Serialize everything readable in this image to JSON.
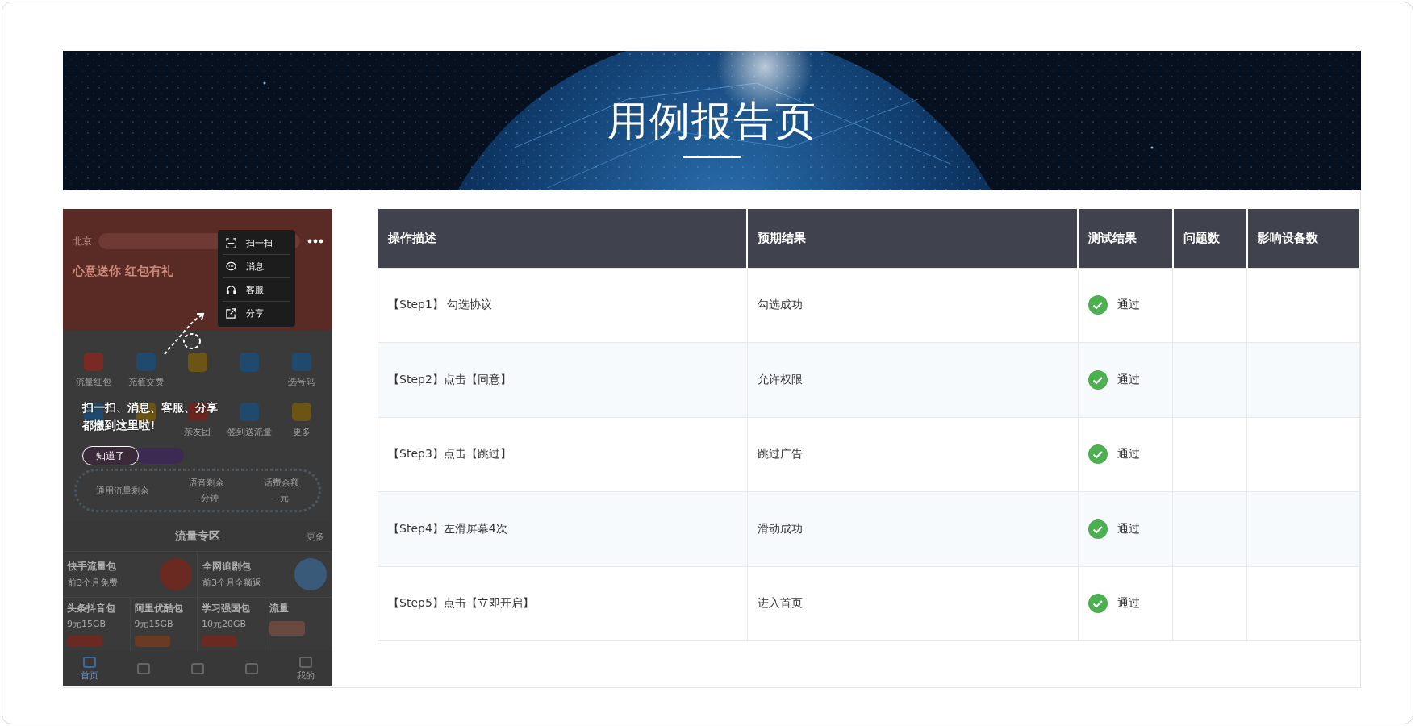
{
  "banner": {
    "title": "用例报告页"
  },
  "phone": {
    "city": "北京",
    "promo_title": "心意送你 红包有礼",
    "shortcuts": [
      {
        "label": "流量红包",
        "color": "#7a2a22"
      },
      {
        "label": "充值交费",
        "color": "#1f4a6e"
      },
      {
        "color": "#6b5414"
      },
      {
        "color": "#1f4a6e"
      },
      {
        "label": "选号码",
        "color": "#1f4a6e"
      },
      {
        "color": "#1f4a6e"
      },
      {
        "color": "#6b5414"
      },
      {
        "label": "亲友团",
        "color": "#6b2620"
      },
      {
        "label": "签到送流量",
        "color": "#1f4a6e"
      },
      {
        "label": "更多",
        "color": "#6b5414"
      }
    ],
    "balance": [
      {
        "label": "通用流量剩余"
      },
      {
        "label": "语音剩余",
        "value": "--分钟"
      },
      {
        "label": "话费余额",
        "value": "--元"
      }
    ],
    "section_title": "流量专区",
    "section_more": "更多",
    "big_products": [
      {
        "name": "快手流量包",
        "note": "前3个月免费"
      },
      {
        "name": "全网追剧包",
        "note": "前3个月全额返"
      }
    ],
    "products": [
      {
        "name": "头条抖音包",
        "price": "9元15GB"
      },
      {
        "name": "阿里优酷包",
        "price": "9元15GB"
      },
      {
        "name": "学习强国包",
        "price": "10元20GB"
      },
      {
        "name": "流量"
      }
    ],
    "nav": [
      {
        "label": "首页",
        "selected": true
      },
      {
        "selected": false
      },
      {
        "selected": false
      },
      {
        "selected": false
      },
      {
        "label": "我的",
        "selected": false
      }
    ],
    "menu": [
      {
        "label": "扫一扫"
      },
      {
        "label": "消息"
      },
      {
        "label": "客服"
      },
      {
        "label": "分享"
      }
    ],
    "hint_lines": [
      "扫一扫、消息、客服、分享",
      "都搬到这里啦!"
    ],
    "dismiss_button": "知道了"
  },
  "table": {
    "columns": [
      "操作描述",
      "预期结果",
      "测试结果",
      "问题数",
      "影响设备数"
    ],
    "rows": [
      {
        "step": "【Step1】 勾选协议",
        "expected": "勾选成功",
        "result": {
          "passed": true,
          "label": "通过"
        }
      },
      {
        "step": "【Step2】点击【同意】",
        "expected": "允许权限",
        "result": {
          "passed": true,
          "label": "通过"
        }
      },
      {
        "step": "【Step3】点击【跳过】",
        "expected": "跳过广告",
        "result": {
          "passed": true,
          "label": "通过"
        }
      },
      {
        "step": "【Step4】左滑屏幕4次",
        "expected": "滑动成功",
        "result": {
          "passed": true,
          "label": "通过"
        }
      },
      {
        "step": "【Step5】点击【立即开启】",
        "expected": "进入首页",
        "result": {
          "passed": true,
          "label": "通过"
        }
      }
    ]
  }
}
